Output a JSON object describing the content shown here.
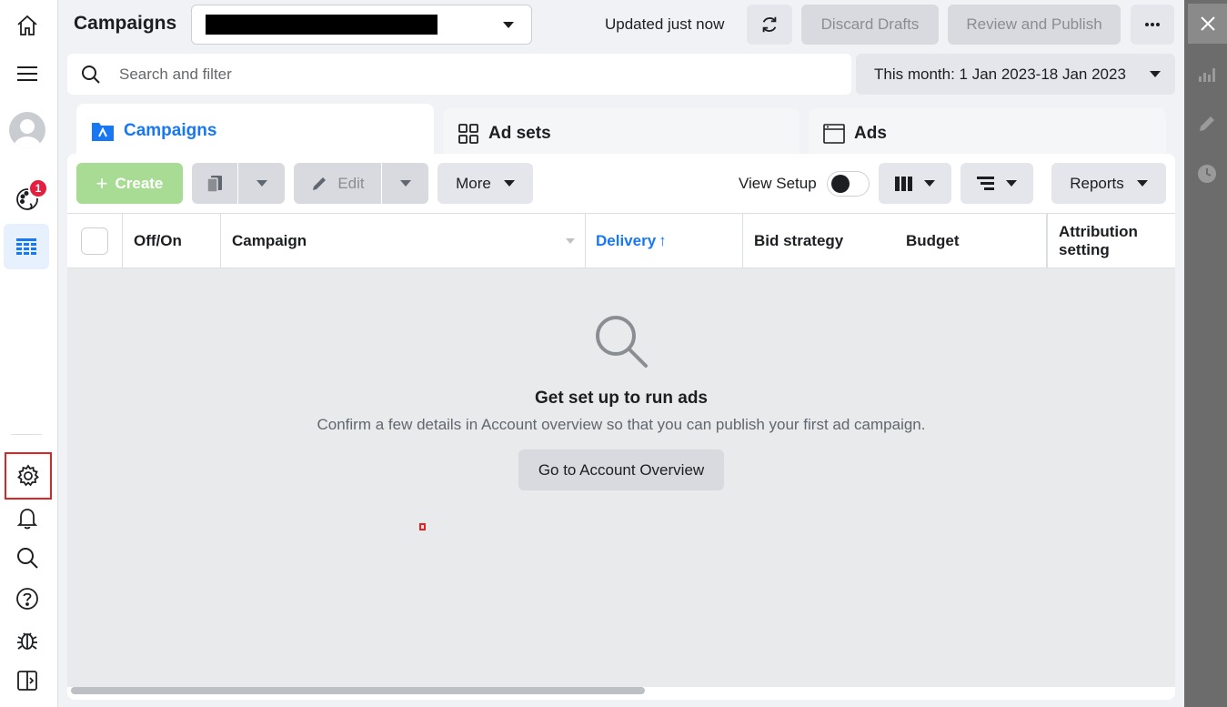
{
  "header": {
    "title": "Campaigns",
    "updated_text": "Updated just now",
    "discard_label": "Discard Drafts",
    "publish_label": "Review and Publish"
  },
  "search": {
    "placeholder": "Search and filter"
  },
  "date_range": {
    "label": "This month: 1 Jan 2023-18 Jan 2023"
  },
  "tabs": [
    {
      "label": "Campaigns",
      "icon": "folder-icon"
    },
    {
      "label": "Ad sets",
      "icon": "grid-icon"
    },
    {
      "label": "Ads",
      "icon": "window-icon"
    }
  ],
  "toolbar": {
    "create_label": "Create",
    "edit_label": "Edit",
    "more_label": "More",
    "view_setup_label": "View Setup",
    "reports_label": "Reports"
  },
  "table": {
    "columns": [
      "Off/On",
      "Campaign",
      "Delivery",
      "Bid strategy",
      "Budget",
      "Attribution setting"
    ],
    "delivery_sort_arrow": "↑"
  },
  "empty_state": {
    "title": "Get set up to run ads",
    "description": "Confirm a few details in Account overview so that you can publish your first ad campaign.",
    "button_label": "Go to Account Overview"
  },
  "left_nav": {
    "notification_count": "1"
  },
  "colors": {
    "accent": "#1877f2",
    "create_button": "#a8dc94",
    "badge": "#e41e3f",
    "right_rail": "#6c6c6c"
  }
}
